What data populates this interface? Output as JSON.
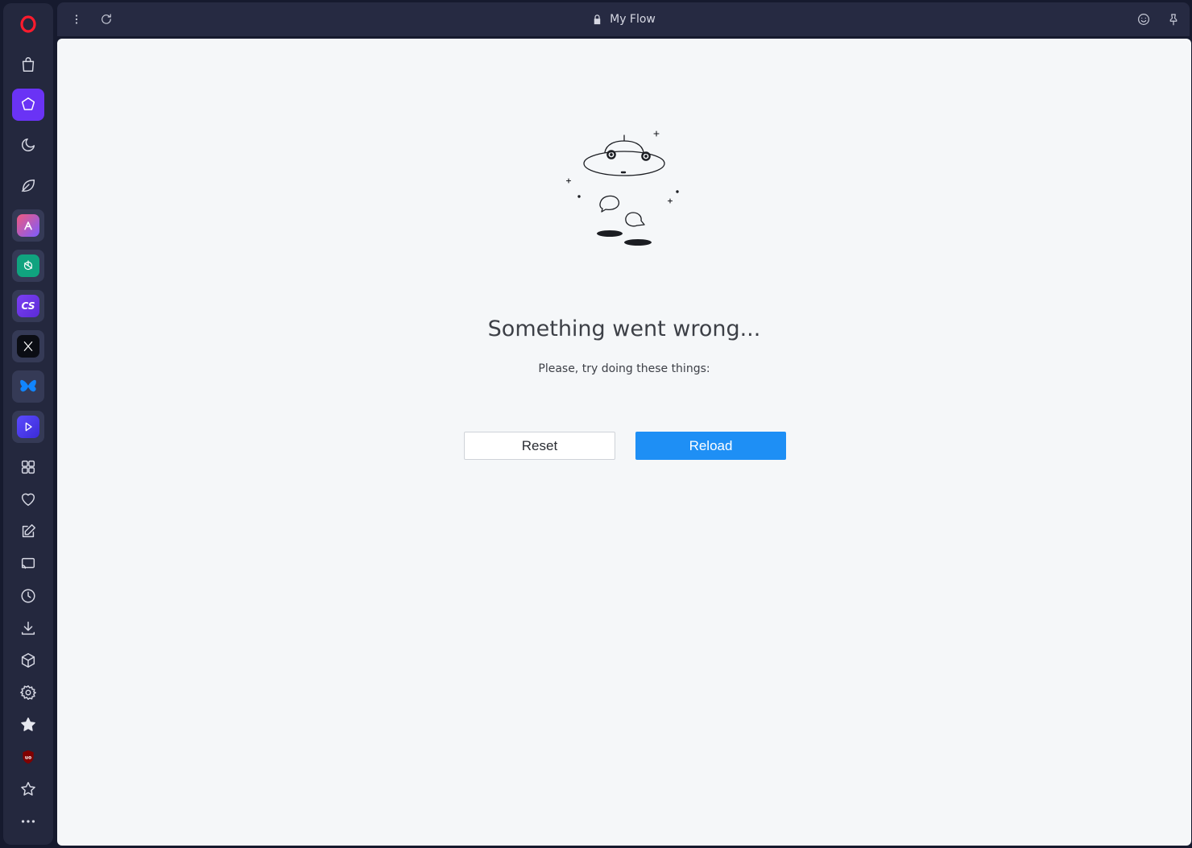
{
  "window": {
    "title": "My Flow"
  },
  "content": {
    "heading": "Something went wrong...",
    "subheading": "Please, try doing these things:",
    "reset_label": "Reset",
    "reload_label": "Reload"
  },
  "sidebar": {
    "items": [
      {
        "name": "opera-logo-icon",
        "type": "logo",
        "color": "#ff1b2d"
      },
      {
        "name": "shopping-bag-icon"
      },
      {
        "name": "my-flow-icon",
        "active": true,
        "color": "#6a33f5"
      },
      {
        "name": "moon-icon"
      },
      {
        "name": "leaf-icon"
      },
      {
        "name": "aria-icon",
        "app": true
      },
      {
        "name": "chatgpt-icon",
        "app": true,
        "color": "#10a37f"
      },
      {
        "name": "chatsonic-icon",
        "app": true,
        "label": "CS"
      },
      {
        "name": "x-twitter-icon",
        "app": true
      },
      {
        "name": "bluesky-icon",
        "app": true,
        "color": "#1185fe"
      },
      {
        "name": "player-icon",
        "app": true
      },
      {
        "name": "grid-icon"
      },
      {
        "name": "heart-icon"
      },
      {
        "name": "edit-icon"
      },
      {
        "name": "cast-icon"
      },
      {
        "name": "history-icon"
      },
      {
        "name": "download-icon"
      },
      {
        "name": "box-icon"
      },
      {
        "name": "settings-icon"
      },
      {
        "name": "star-filled-icon"
      },
      {
        "name": "ublock-icon",
        "color": "#800000",
        "label": "uo"
      },
      {
        "name": "star-outline-icon"
      },
      {
        "name": "more-icon"
      }
    ]
  },
  "topbar": {
    "icons": [
      "menu-dots-icon",
      "reload-icon",
      "lock-icon",
      "emoji-icon",
      "pin-icon"
    ]
  },
  "colors": {
    "accent": "#1e8ff5",
    "sidebar_active": "#6a33f5",
    "background": "#f5f7f9",
    "chrome": "#262a42"
  }
}
